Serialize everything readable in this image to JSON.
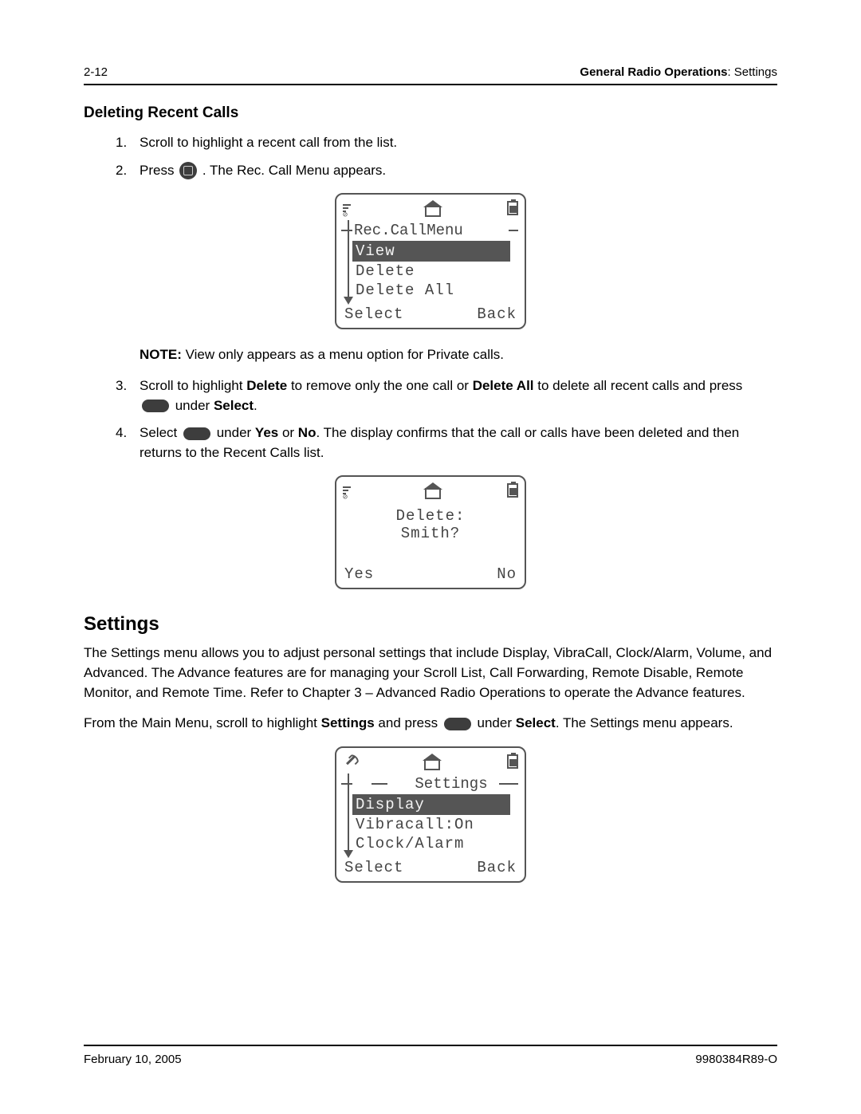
{
  "header": {
    "page_num": "2-12",
    "chapter_bold": "General Radio Operations",
    "chapter_rest": ": Settings"
  },
  "section1": {
    "title": "Deleting Recent Calls",
    "step1": "Scroll to highlight a recent call from the list.",
    "step2_pre": "Press ",
    "step2_post": " . The Rec. Call Menu appears.",
    "note_bold": "NOTE:",
    "note_rest": " View only appears as a menu option for Private calls.",
    "step3_a": "Scroll to highlight ",
    "step3_b": "Delete",
    "step3_c": " to remove only the one call or ",
    "step3_d": "Delete All",
    "step3_e": " to delete all recent calls and press ",
    "step3_f": " under ",
    "step3_g": "Select",
    "step3_h": ".",
    "step4_a": "Select ",
    "step4_b": " under ",
    "step4_c": "Yes",
    "step4_d": " or ",
    "step4_e": "No",
    "step4_f": ". The display confirms that the call or calls have been deleted and then returns to the Recent Calls list."
  },
  "screen1": {
    "title": "Rec.CallMenu",
    "items": [
      "View",
      "Delete",
      "Delete All"
    ],
    "soft_left": "Select",
    "soft_right": "Back"
  },
  "screen2": {
    "line1": "Delete:",
    "line2": "Smith?",
    "soft_left": "Yes",
    "soft_right": "No"
  },
  "section2": {
    "title": "Settings",
    "para1": "The Settings menu allows you to adjust personal settings that include Display, VibraCall, Clock/Alarm, Volume, and Advanced. The Advance features are for managing your Scroll List, Call Forwarding, Remote Disable, Remote Monitor, and Remote Time. Refer to Chapter 3 – Advanced Radio Operations to operate the Advance features.",
    "para2_a": "From the Main Menu, scroll to highlight ",
    "para2_b": "Settings",
    "para2_c": " and press ",
    "para2_d": " under ",
    "para2_e": "Select",
    "para2_f": ". The Settings menu appears."
  },
  "screen3": {
    "title": "Settings",
    "items": [
      "Display",
      "Vibracall:On",
      "Clock/Alarm"
    ],
    "soft_left": "Select",
    "soft_right": "Back"
  },
  "footer": {
    "date": "February 10, 2005",
    "doc": "9980384R89-O"
  }
}
